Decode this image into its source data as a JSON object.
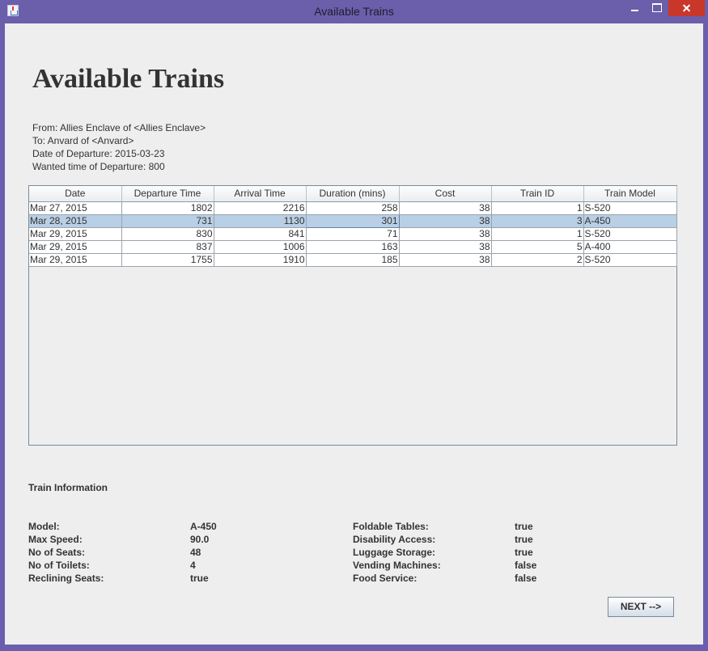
{
  "window": {
    "title": "Available Trains"
  },
  "heading": "Available Trains",
  "route_info": {
    "from": "From: Allies Enclave of <Allies Enclave>",
    "to": "To: Anvard of <Anvard>",
    "departure_date": "Date of Departure: 2015-03-23",
    "wanted_time": "Wanted time of Departure: 800"
  },
  "table": {
    "columns": [
      "Date",
      "Departure Time",
      "Arrival Time",
      "Duration (mins)",
      "Cost",
      "Train ID",
      "Train Model"
    ],
    "rows": [
      [
        "Mar 27, 2015",
        "1802",
        "2216",
        "258",
        "38",
        "1",
        "S-520"
      ],
      [
        "Mar 28, 2015",
        "731",
        "1130",
        "301",
        "38",
        "3",
        "A-450"
      ],
      [
        "Mar 29, 2015",
        "830",
        "841",
        "71",
        "38",
        "1",
        "S-520"
      ],
      [
        "Mar 29, 2015",
        "837",
        "1006",
        "163",
        "38",
        "5",
        "A-400"
      ],
      [
        "Mar 29, 2015",
        "1755",
        "1910",
        "185",
        "38",
        "2",
        "S-520"
      ]
    ],
    "selected_row": 1
  },
  "train_info": {
    "title": "Train Information",
    "left": [
      {
        "label": "Model:",
        "value": "A-450"
      },
      {
        "label": "Max Speed:",
        "value": "90.0"
      },
      {
        "label": "No of Seats:",
        "value": "48"
      },
      {
        "label": "No of Toilets:",
        "value": "4"
      },
      {
        "label": "Reclining Seats:",
        "value": "true"
      }
    ],
    "right": [
      {
        "label": "Foldable Tables:",
        "value": "true"
      },
      {
        "label": "Disability Access:",
        "value": "true"
      },
      {
        "label": "Luggage Storage:",
        "value": "true"
      },
      {
        "label": "Vending Machines:",
        "value": "false"
      },
      {
        "label": "Food Service:",
        "value": "false"
      }
    ]
  },
  "next_button": {
    "label": "NEXT -->"
  }
}
